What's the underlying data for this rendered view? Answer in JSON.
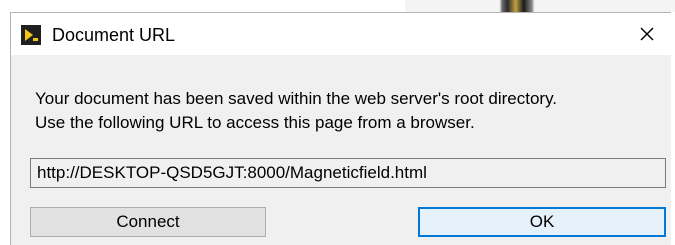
{
  "window": {
    "title": "Document URL",
    "app_icon": "labview-icon",
    "close_icon": "close-icon"
  },
  "message": {
    "line1": "Your document has been saved within the web server's root directory.",
    "line2": "Use the following URL to access this page from a browser."
  },
  "url_field": {
    "value": "http://DESKTOP-QSD5GJT:8000/Magneticfield.html"
  },
  "buttons": {
    "connect_label": "Connect",
    "ok_label": "OK"
  },
  "colors": {
    "accent": "#0078d7",
    "dialog_bg": "#f0f0f0",
    "titlebar_bg": "#ffffff"
  }
}
